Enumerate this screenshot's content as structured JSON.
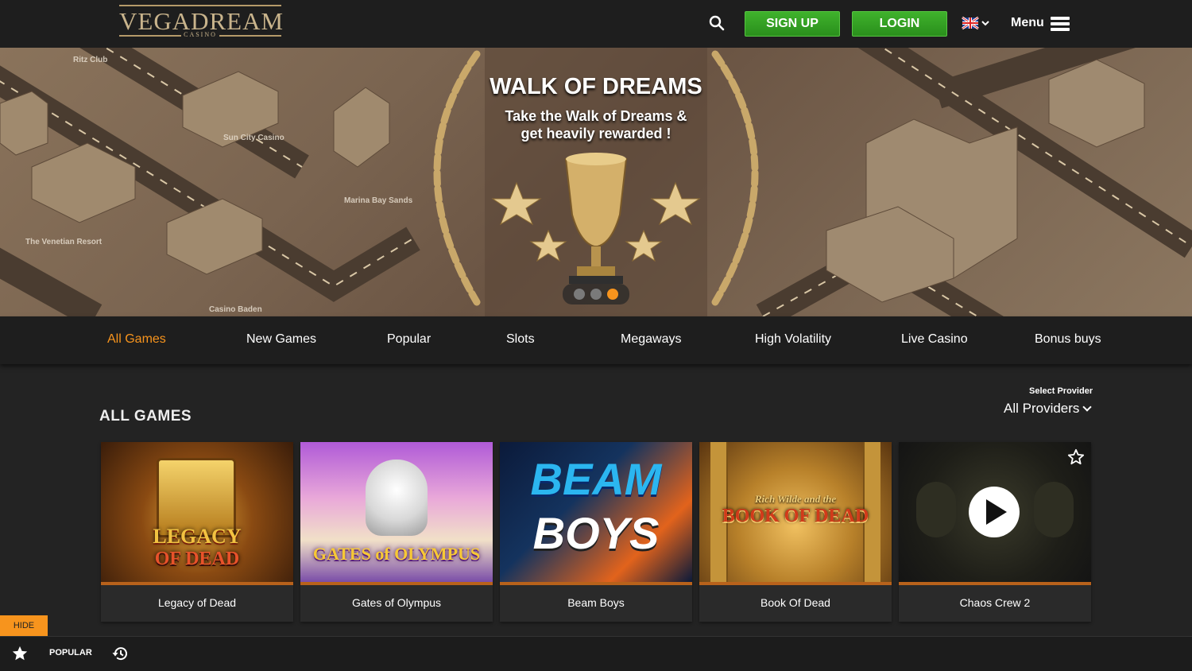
{
  "header": {
    "logo_text": "VEGADREAM",
    "logo_sub": "CASINO",
    "signup_label": "SIGN UP",
    "login_label": "LOGIN",
    "menu_label": "Menu",
    "search_icon": "search-icon",
    "language_flag": "uk-flag-icon"
  },
  "banner": {
    "title": "WALK OF DREAMS",
    "subtitle_line1": "Take the Walk of Dreams &",
    "subtitle_line2": "get heavily rewarded !",
    "places": [
      "Ritz Club",
      "Sun City Casino",
      "Marina Bay Sands",
      "The Venetian Resort",
      "Casino Baden"
    ],
    "slides_count": 3,
    "active_slide": 3
  },
  "categories": [
    {
      "label": "All Games",
      "active": true
    },
    {
      "label": "New Games",
      "active": false
    },
    {
      "label": "Popular",
      "active": false
    },
    {
      "label": "Slots",
      "active": false
    },
    {
      "label": "Megaways",
      "active": false
    },
    {
      "label": "High Volatility",
      "active": false
    },
    {
      "label": "Live Casino",
      "active": false
    },
    {
      "label": "Bonus buys",
      "active": false
    }
  ],
  "section": {
    "title": "ALL GAMES",
    "provider_label": "Select Provider",
    "provider_value": "All Providers"
  },
  "games": [
    {
      "name": "Legacy of Dead",
      "art_line1": "LEGACY",
      "art_line2": "OF DEAD"
    },
    {
      "name": "Gates of Olympus",
      "art_line1": "GATES of OLYMPUS"
    },
    {
      "name": "Beam Boys",
      "art_line1": "BEAM",
      "art_line2": "BOYS"
    },
    {
      "name": "Book Of Dead",
      "art_line1": "Rich Wilde and the",
      "art_line2": "BOOK OF DEAD"
    },
    {
      "name": "Chaos Crew 2"
    }
  ],
  "bottom_bar": {
    "hide_label": "HIDE",
    "popular_label": "POPULAR"
  },
  "colors": {
    "accent": "#f7941d",
    "green_button": "#2a8f1c",
    "background": "#232323"
  }
}
